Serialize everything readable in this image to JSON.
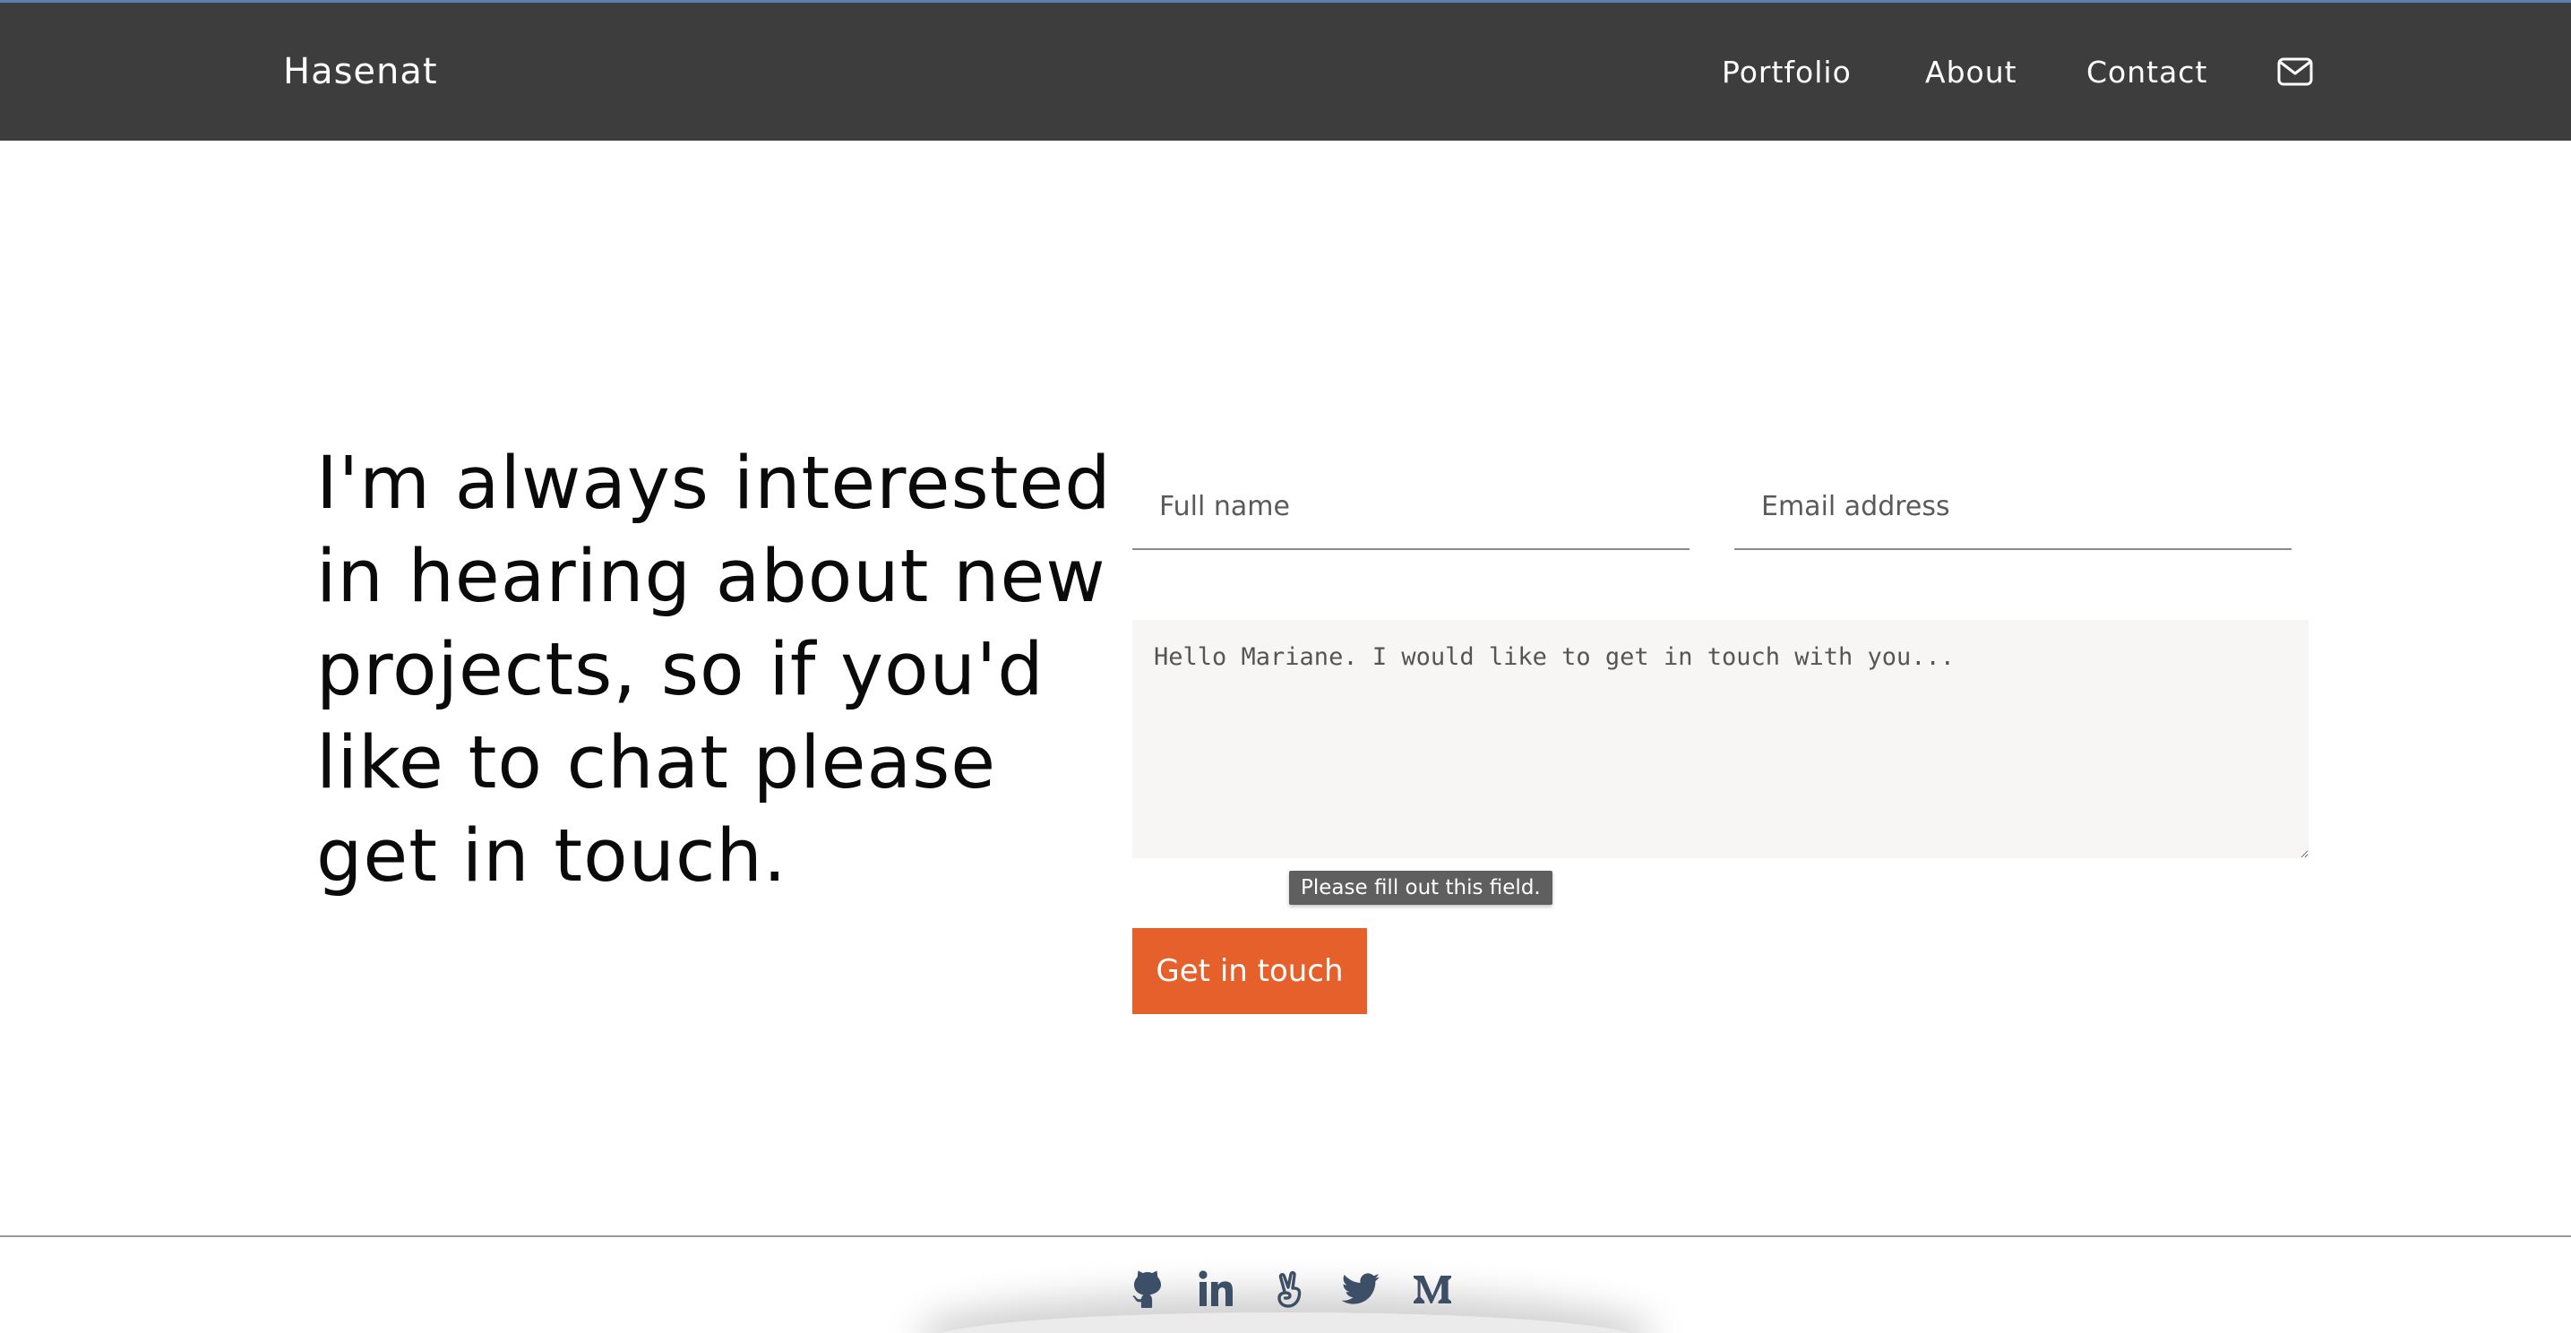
{
  "header": {
    "brand": "Hasenat",
    "nav": {
      "portfolio": "Portfolio",
      "about": "About",
      "contact": "Contact"
    },
    "mail_icon": "mail-icon"
  },
  "hero": {
    "statement": "I'm always interested in hearing about new projects, so if you'd like to chat please get in touch."
  },
  "form": {
    "full_name_placeholder": "Full name",
    "email_placeholder": "Email address",
    "message_placeholder": "Hello Mariane. I would like to get in touch with you...",
    "validation_tooltip": "Please fill out this field.",
    "submit_label": "Get in touch"
  },
  "footer": {
    "social": [
      "github-icon",
      "linkedin-icon",
      "angellist-icon",
      "twitter-icon",
      "medium-icon"
    ]
  },
  "colors": {
    "nav_bg": "#3e3d3e",
    "accent": "#e5602a",
    "social_icon": "#3d4f66"
  }
}
